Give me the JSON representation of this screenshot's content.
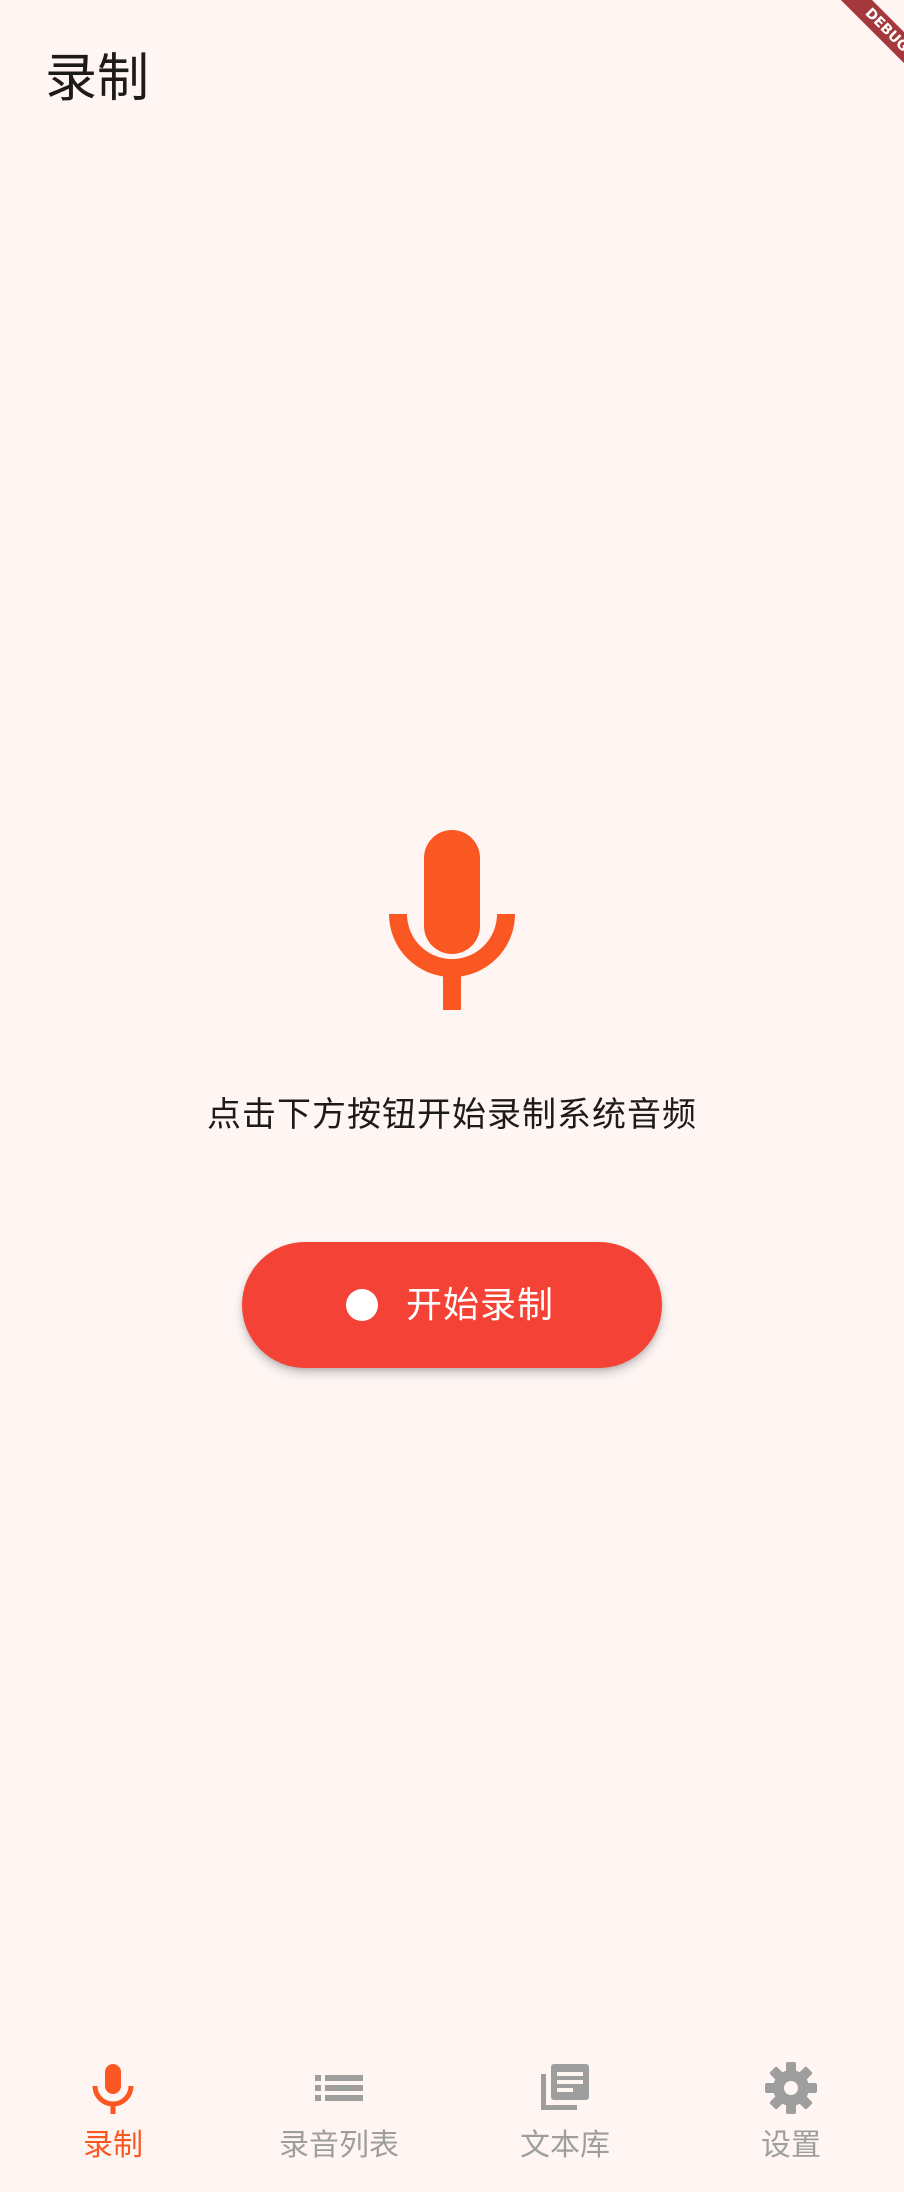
{
  "app_bar": {
    "title": "录制"
  },
  "debug_banner": {
    "text": "DEBUG"
  },
  "main": {
    "hero_icon": "mic-icon",
    "prompt": "点击下方按钮开始录制系统音频",
    "start_button": {
      "icon": "record-dot-icon",
      "label": "开始录制"
    }
  },
  "bottom_nav": {
    "items": [
      {
        "label": "录制",
        "icon": "mic-icon",
        "active": true
      },
      {
        "label": "录音列表",
        "icon": "list-icon",
        "active": false
      },
      {
        "label": "文本库",
        "icon": "library-books-icon",
        "active": false
      },
      {
        "label": "设置",
        "icon": "gear-icon",
        "active": false
      }
    ]
  },
  "colors": {
    "background": "#fff6f4",
    "accent": "#fa5722",
    "button": "#f44336",
    "inactive": "#9e9e9e",
    "text": "#1d1b1a"
  }
}
